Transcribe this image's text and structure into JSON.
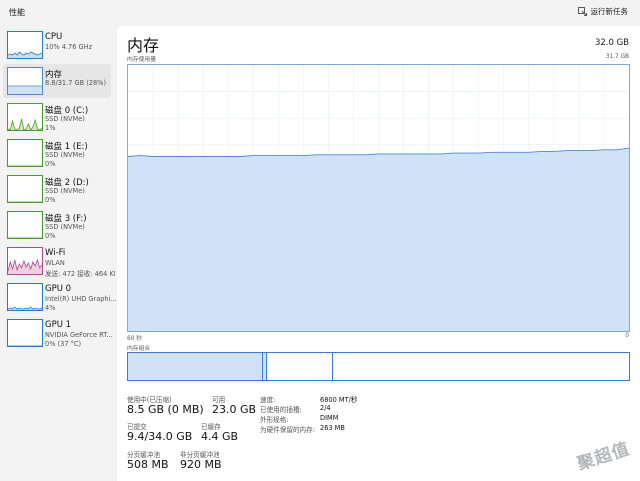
{
  "window": {
    "title": "性能"
  },
  "toolbar": {
    "new_task_label": "运行新任务"
  },
  "sidebar": {
    "items": [
      {
        "name": "CPU",
        "sub1": "10%  4.76 GHz",
        "sub2": "",
        "color": "#1f7ad6",
        "active": false
      },
      {
        "name": "内存",
        "sub1": "8.8/31.7 GB (28%)",
        "sub2": "",
        "color": "#4a8ad8",
        "active": true
      },
      {
        "name": "磁盘 0 (C:)",
        "sub1": "SSD (NVMe)",
        "sub2": "1%",
        "color": "#4c9a2a",
        "active": false
      },
      {
        "name": "磁盘 1 (E:)",
        "sub1": "SSD (NVMe)",
        "sub2": "0%",
        "color": "#4c9a2a",
        "active": false
      },
      {
        "name": "磁盘 2 (D:)",
        "sub1": "SSD (NVMe)",
        "sub2": "0%",
        "color": "#4c9a2a",
        "active": false
      },
      {
        "name": "磁盘 3 (F:)",
        "sub1": "SSD (NVMe)",
        "sub2": "0%",
        "color": "#4c9a2a",
        "active": false
      },
      {
        "name": "Wi-Fi",
        "sub1": "WLAN",
        "sub2": "发送: 472  接收: 464 Kl",
        "color": "#b3478c",
        "active": false
      },
      {
        "name": "GPU 0",
        "sub1": "Intel(R) UHD Graphi...",
        "sub2": "4%",
        "color": "#1f7ad6",
        "active": false
      },
      {
        "name": "GPU 1",
        "sub1": "NVIDIA GeForce RT...",
        "sub2": "0% (37 °C)",
        "color": "#1f7ad6",
        "active": false
      }
    ]
  },
  "main": {
    "title": "内存",
    "total": "32.0 GB",
    "usage_label": "内存使用量",
    "usage_max": "31.7 GB",
    "time_left": "60 秒",
    "time_right": "0",
    "composition_label": "内存组合",
    "usage_series_gb": [
      20.8,
      20.9,
      20.8,
      20.8,
      20.8,
      20.8,
      20.8,
      20.8,
      20.8,
      20.8,
      20.9,
      20.9,
      20.9,
      20.9,
      20.9,
      21.0,
      21.0,
      21.0,
      21.0,
      21.0,
      21.1,
      21.1,
      21.1,
      21.1,
      21.1,
      21.1,
      21.2,
      21.2,
      21.2,
      21.3,
      21.3,
      21.3,
      21.3,
      21.4,
      21.4,
      21.5,
      21.5,
      21.5,
      21.6,
      21.6,
      21.8
    ],
    "stats": {
      "in_use_label": "使用中(已压缩)",
      "in_use_value": "8.5 GB (0 MB)",
      "available_label": "可用",
      "available_value": "23.0 GB",
      "committed_label": "已提交",
      "committed_value": "9.4/34.0 GB",
      "cached_label": "已缓存",
      "cached_value": "4.4 GB",
      "paged_label": "分页缓冲池",
      "paged_value": "508 MB",
      "nonpaged_label": "非分页缓冲池",
      "nonpaged_value": "920 MB"
    },
    "details": [
      {
        "label": "速度:",
        "value": "6800 MT/秒"
      },
      {
        "label": "已使用的插槽:",
        "value": "2/4"
      },
      {
        "label": "外形规格:",
        "value": "DIMM"
      },
      {
        "label": "为硬件保留的内存:",
        "value": "263 MB"
      }
    ]
  },
  "colors": {
    "memory_fill": "#cfe2f8",
    "memory_line": "#4a8ad8",
    "grid": "#e9eef5"
  },
  "watermark": "聚超值"
}
